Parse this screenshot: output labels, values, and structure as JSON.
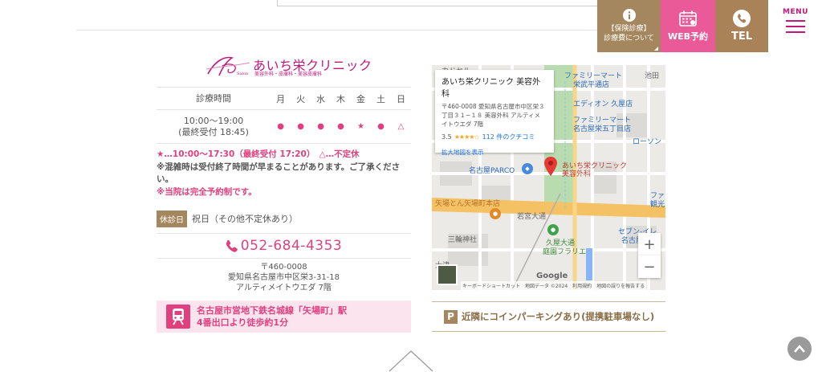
{
  "header": {
    "insurance_line1": "【保険診療】",
    "insurance_line2": "診療費について",
    "web_label": "WEB予約",
    "tel_label": "TEL",
    "menu_label": "MENU"
  },
  "clinic": {
    "logo_text": "あいち栄クリニック",
    "logo_sub": "美容外科・皮膚科・美容皮膚科"
  },
  "hours": {
    "header_label": "診療時間",
    "days": [
      "月",
      "火",
      "水",
      "木",
      "金",
      "土",
      "日"
    ],
    "time_main": "10:00〜19:00",
    "time_last": "(最終受付 18:45)",
    "marks": [
      "●",
      "●",
      "●",
      "●",
      "★",
      "●",
      "△"
    ]
  },
  "notes": {
    "star_note": "★…10:00〜17:30（最終受付 17:20）　△…不定休",
    "crowd_note": "※混雑時は受付終了時間が早まることがあります。ご了承ください。",
    "reservation_note": "※当院は完全予約制です。"
  },
  "closed": {
    "tag": "休診日",
    "value": "祝日（その他不定休あり）"
  },
  "phone": {
    "number": "052-684-4353"
  },
  "address": {
    "postal": "〒460-0008",
    "line1": "愛知県名古屋市中区栄3-31-18",
    "line2": "アルティメイトウエダ 7階"
  },
  "access": {
    "line1": "名古屋市営地下鉄名城線「矢場町」駅",
    "line2": "4番出口より徒歩約1分"
  },
  "map": {
    "card_name": "あいち栄クリニック 美容外科",
    "card_addr1": "〒460-0008 愛知県名古屋市中区栄３",
    "card_addr2": "丁目３１−１８ 美容外科 アルティメ",
    "card_addr3": "イトウエダ 7階",
    "rating": "3.5",
    "stars": "★★★★☆",
    "reviews": "112 件のクチコミ",
    "enlarge": "拡大地図を表示",
    "labels": {
      "family_mart1": "ファミリーマート",
      "family_mart1b": "栄武平通店",
      "eon": "エディオン 久屋店",
      "family_mart2": "ファミリーマート",
      "family_mart2b": "名古屋栄五丁目店",
      "lawson": "ローソン",
      "parco": "名古屋PARCO",
      "clinic_pin1": "あいち栄クリニック",
      "clinic_pin2": "美容外科",
      "yabaton": "矢場とん矢場町本店",
      "wakamiya": "若宮大通",
      "miwa": "三輪神社",
      "hisaya1": "久屋大通",
      "hisaya2": "庭園フラリエ",
      "seven1": "セブン-イレ",
      "seven2": "名古屋",
      "otsu": "大津",
      "family3": "ファ",
      "family3b": "観光",
      "kadoku": "カドセル",
      "ikeda": "池田"
    },
    "zoom_in": "+",
    "zoom_out": "−",
    "footer": "キーボードショートカット　地図データ ©2024　利用規約　地図の誤りを報告する",
    "google": "Google"
  },
  "parking": {
    "icon": "P",
    "text": "近隣にコインパーキングあり(提携駐車場なし)"
  }
}
